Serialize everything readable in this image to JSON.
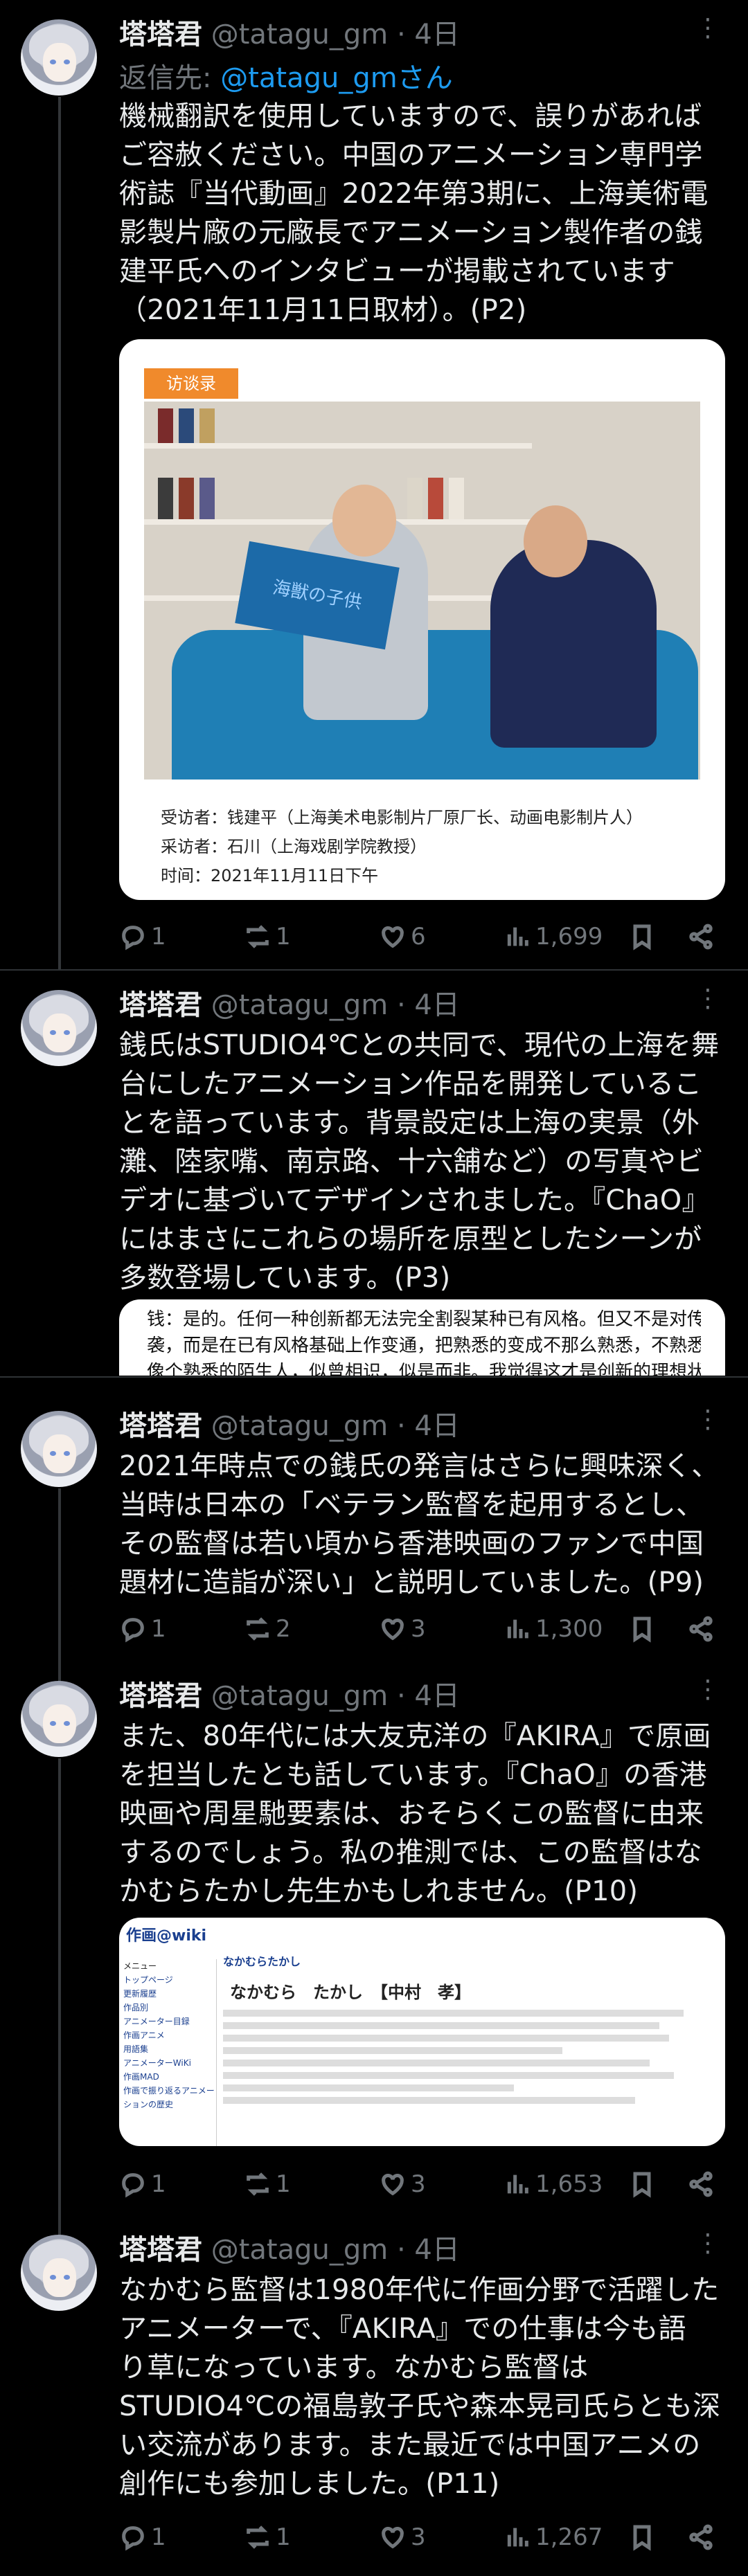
{
  "colors": {
    "background": "#000000",
    "text": "#e7e9ea",
    "muted": "#71767b",
    "link": "#1d9bf0",
    "divider": "#2f3336"
  },
  "tweets": [
    {
      "name": "塔塔君",
      "handle": "@tatagu_gm",
      "time": "· 4日",
      "reply_prefix": "返信先: ",
      "reply_link": "@tatagu_gmさん",
      "text": "機械翻訳を使用していますので、誤りがあれば\nご容赦ください。中国のアニメーション専門学\n術誌『当代動画』2022年第3期に、上海美術電\n影製片廠の元廠長でアニメーション製作者の銭\n建平氏へのインタビューが掲載されています\n（2021年11月11日取材）。(P2)",
      "media": {
        "tag": "访谈录",
        "book_title": "海獣の子供",
        "caption": [
          "受访者：钱建平（上海美术电影制片厂原厂长、动画电影制片人）",
          "采访者：石川（上海戏剧学院教授）",
          "时间：2021年11月11日下午"
        ]
      },
      "stats": {
        "replies": "1",
        "reposts": "1",
        "likes": "6",
        "views": "1,699"
      }
    },
    {
      "name": "塔塔君",
      "handle": "@tatagu_gm",
      "time": "· 4日",
      "text": "銭氏はSTUDIO4℃との共同で、現代の上海を舞\n台にしたアニメーション作品を開発しているこ\nとを語っています。背景設定は上海の実景（外\n灘、陸家嘴、南京路、十六舗など）の写真やビ\nデオに基づいてデザインされました。『ChaO』\nにはまさにこれらの場所を原型としたシーンが\n多数登場しています。(P3)",
      "media": {
        "excerpt": [
          "钱：是的。任何一种创新都无法完全割裂某种已有风格。但又不是对传统简单的模仿抄",
          "袭，而是在已有风格基础上作变通，把熟悉的变成不那么熟悉，不熟悉中又有熟悉的元素，",
          "像个熟悉的陌生人，似曾相识，似是而非。我觉得这才是创新的理想状态。我最近在和日本"
        ]
      }
    },
    {
      "name": "塔塔君",
      "handle": "@tatagu_gm",
      "time": "· 4日",
      "text": "2021年時点での銭氏の発言はさらに興味深く、\n当時は日本の「ベテラン監督を起用するとし、\nその監督は若い頃から香港映画のファンで中国\n題材に造詣が深い」と説明していました。(P9)",
      "stats": {
        "replies": "1",
        "reposts": "2",
        "likes": "3",
        "views": "1,300"
      }
    },
    {
      "name": "塔塔君",
      "handle": "@tatagu_gm",
      "time": "· 4日",
      "text": "また、80年代には大友克洋の『AKIRA』で原画\nを担当したとも話しています。『ChaO』の香港\n映画や周星馳要素は、おそらくこの監督に由来\nするのでしょう。私の推測では、この監督はな\nかむらたかし先生かもしれません。(P10)",
      "media": {
        "site": "作画@wiki",
        "side_title": "メニュー",
        "side_items": [
          "トップページ",
          "更新履歴",
          "作品別",
          "アニメーター目録",
          "作画アニメ",
          "用語集",
          "アニメーターWiKi",
          "作画MAD",
          "作画で振り返るアニメーションの歴史"
        ],
        "page_kana": "なかむらたかし",
        "page_name": "なかむら　たかし　【中村　孝】"
      },
      "stats": {
        "replies": "1",
        "reposts": "1",
        "likes": "3",
        "views": "1,653"
      }
    },
    {
      "name": "塔塔君",
      "handle": "@tatagu_gm",
      "time": "· 4日",
      "text": "なかむら監督は1980年代に作画分野で活躍した\nアニメーターで、『AKIRA』での仕事は今も語\nり草になっています。なかむら監督は\nSTUDIO4℃の福島敦子氏や森本晃司氏らとも深\nい交流があります。また最近では中国アニメの\n創作にも参加しました。(P11)",
      "stats": {
        "replies": "1",
        "reposts": "1",
        "likes": "3",
        "views": "1,267"
      }
    }
  ]
}
